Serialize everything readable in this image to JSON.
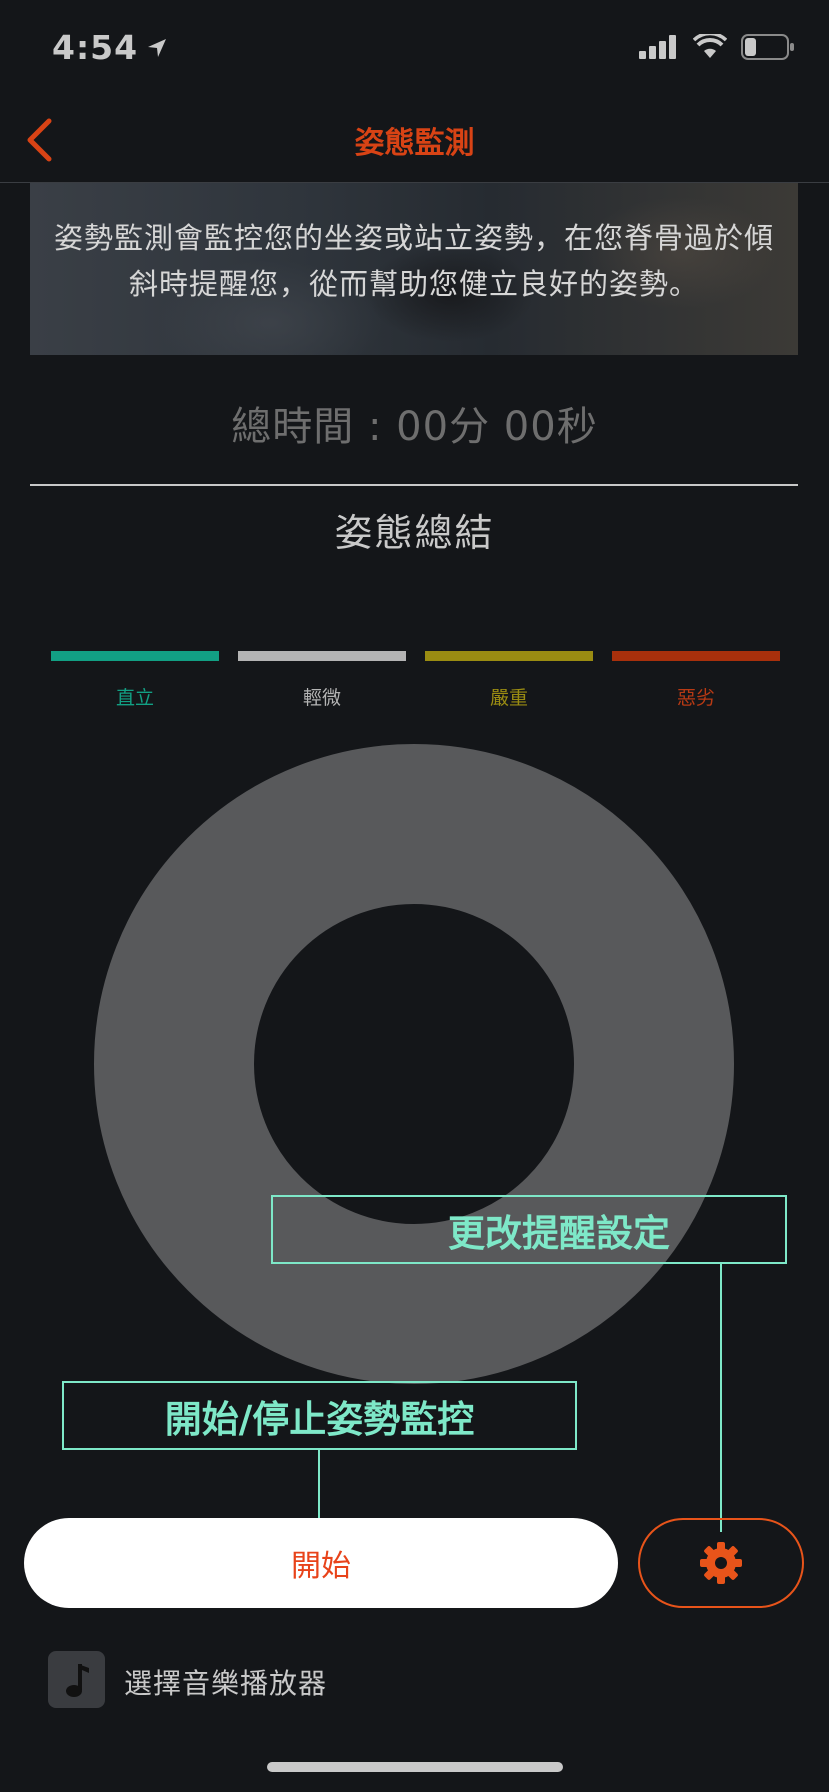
{
  "status_bar": {
    "time": "4:54"
  },
  "nav": {
    "title": "姿態監測"
  },
  "banner": {
    "description": "姿勢監測會監控您的坐姿或站立姿勢，在您脊骨過於傾斜時提醒您，從而幫助您健立良好的姿勢。"
  },
  "total_time": {
    "text": "總時間 : 00分 00秒"
  },
  "summary": {
    "title": "姿態總結",
    "legend": [
      {
        "label": "直立",
        "color": "#12a084"
      },
      {
        "label": "輕微",
        "color": "#b4b4b4"
      },
      {
        "label": "嚴重",
        "color": "#9a8c12"
      },
      {
        "label": "惡劣",
        "color": "#a8300c"
      }
    ]
  },
  "tooltips": {
    "settings": "更改提醒設定",
    "start_stop": "開始/停止姿勢監控"
  },
  "controls": {
    "start_label": "開始"
  },
  "music": {
    "label": "選擇音樂播放器"
  },
  "colors": {
    "accent": "#e8431a",
    "tooltip": "#7ee8c8",
    "donut": "#58595b",
    "background": "#141619"
  }
}
